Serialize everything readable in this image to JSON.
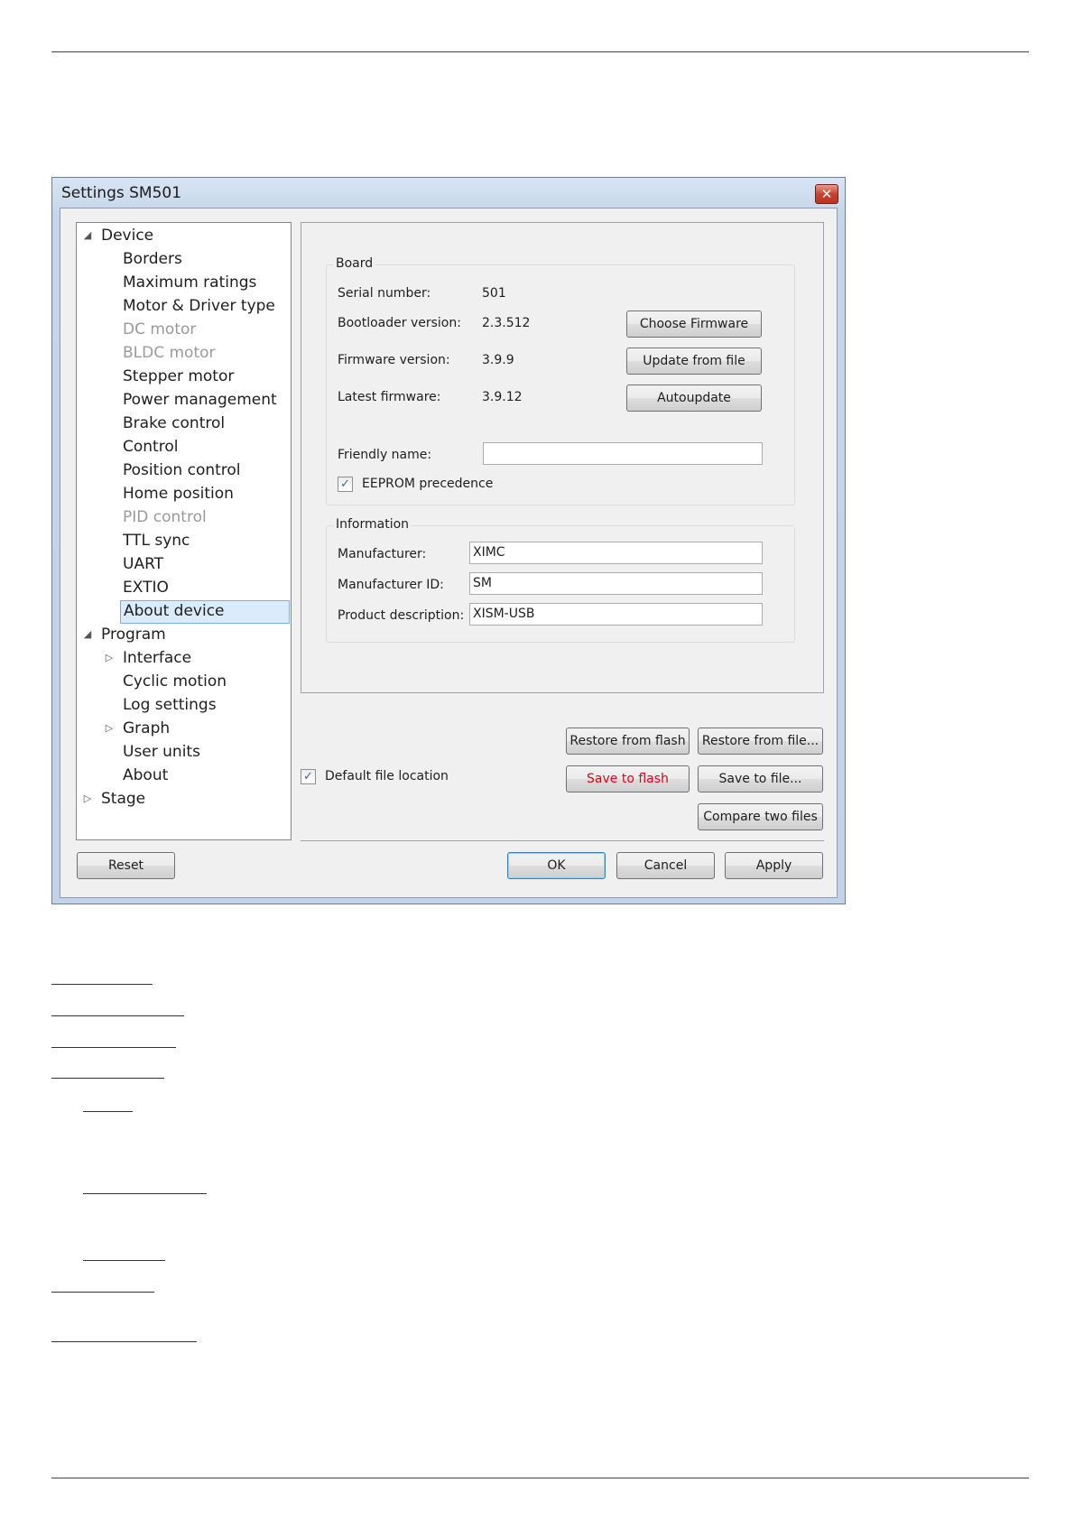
{
  "dialog": {
    "title": "Settings SM501",
    "close_glyph": "✕"
  },
  "tree": {
    "expanded_glyph": "◢",
    "collapsed_glyph": "▷",
    "items": [
      {
        "label": "Device"
      },
      {
        "label": "Borders"
      },
      {
        "label": "Maximum ratings"
      },
      {
        "label": "Motor & Driver type"
      },
      {
        "label": "DC motor"
      },
      {
        "label": "BLDC motor"
      },
      {
        "label": "Stepper motor"
      },
      {
        "label": "Power management"
      },
      {
        "label": "Brake control"
      },
      {
        "label": "Control"
      },
      {
        "label": "Position control"
      },
      {
        "label": "Home position"
      },
      {
        "label": "PID control"
      },
      {
        "label": "TTL sync"
      },
      {
        "label": "UART"
      },
      {
        "label": "EXTIO"
      },
      {
        "label": "About device"
      },
      {
        "label": "Program"
      },
      {
        "label": "Interface"
      },
      {
        "label": "Cyclic motion"
      },
      {
        "label": "Log settings"
      },
      {
        "label": "Graph"
      },
      {
        "label": "User units"
      },
      {
        "label": "About"
      },
      {
        "label": "Stage"
      }
    ]
  },
  "board": {
    "title": "Board",
    "serial_label": "Serial number:",
    "serial_value": "501",
    "bootloader_label": "Bootloader version:",
    "bootloader_value": "2.3.512",
    "firmware_label": "Firmware version:",
    "firmware_value": "3.9.9",
    "latest_label": "Latest firmware:",
    "latest_value": "3.9.12",
    "choose_firmware": "Choose Firmware",
    "update_from_file": "Update from file",
    "autoupdate": "Autoupdate",
    "friendly_label": "Friendly name:",
    "friendly_value": "",
    "eeprom_label": "EEPROM precedence"
  },
  "information": {
    "title": "Information",
    "manufacturer_label": "Manufacturer:",
    "manufacturer_value": "XIMC",
    "manufacturer_id_label": "Manufacturer ID:",
    "manufacturer_id_value": "SM",
    "product_label": "Product description:",
    "product_value": "XISM-USB"
  },
  "files": {
    "restore_flash": "Restore from flash",
    "restore_file": "Restore from file...",
    "save_flash": "Save to flash",
    "save_file": "Save to file...",
    "compare": "Compare two files",
    "default_location": "Default file location"
  },
  "footer": {
    "reset": "Reset",
    "ok": "OK",
    "cancel": "Cancel",
    "apply": "Apply"
  },
  "checkbox_glyph": "✓"
}
